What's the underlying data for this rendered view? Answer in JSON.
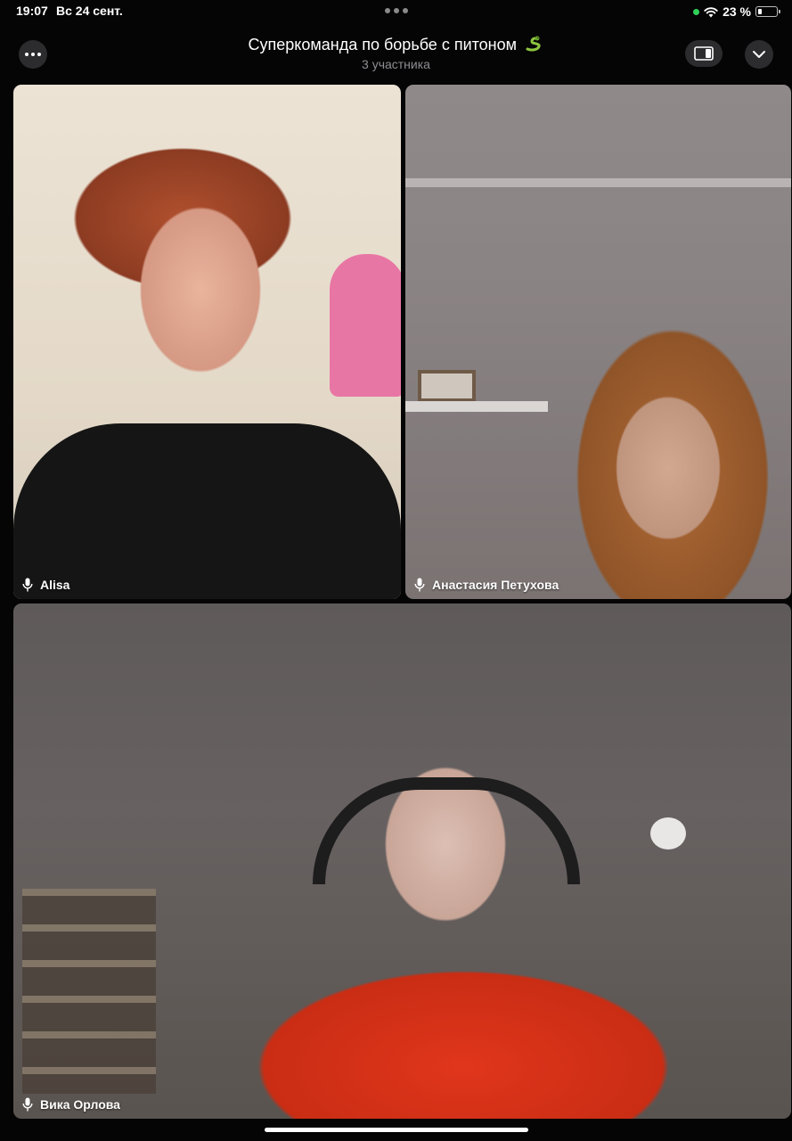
{
  "status_bar": {
    "time": "19:07",
    "date": "Вс 24 сент.",
    "battery_text": "23 %",
    "battery_level_percent": 23,
    "icons": [
      "camera-in-use-indicator",
      "wifi-icon",
      "battery-icon"
    ],
    "camera_indicator_color": "#30d158"
  },
  "header": {
    "title": "Суперкоманда по борьбе с питоном",
    "title_icon": "snake-emoji",
    "subtitle": "3 участника",
    "left_button_icon": "more-icon",
    "right_buttons": [
      "layout-icon",
      "chevron-down-icon"
    ]
  },
  "participants": [
    {
      "name": "Alisa",
      "mic_icon": "mic-icon"
    },
    {
      "name": "Анастасия Петухова",
      "mic_icon": "mic-icon"
    },
    {
      "name": "Вика Орлова",
      "mic_icon": "mic-icon"
    }
  ]
}
